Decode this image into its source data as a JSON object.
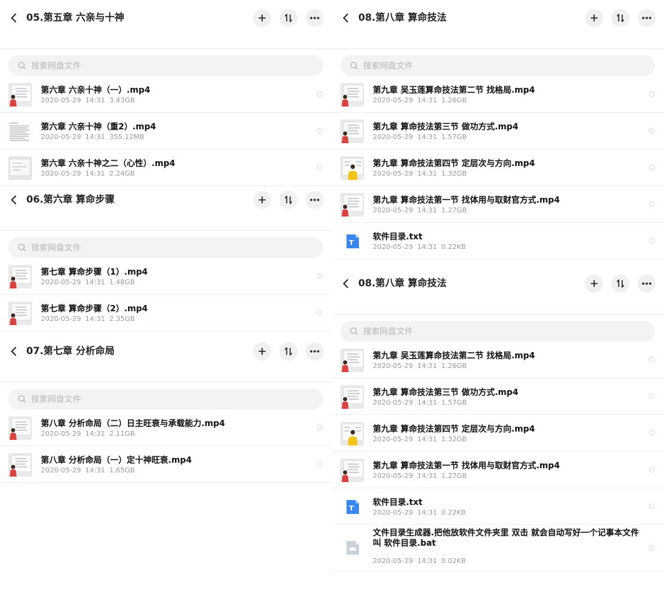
{
  "search_placeholder": "搜索网盘文件",
  "left": {
    "p1": {
      "title": "05.第五章  六亲与十神",
      "files": [
        {
          "name": "第六章  六亲十神（一）.mp4",
          "date": "2020-05-29",
          "time": "14:31",
          "size": "3.43GB",
          "thumb": "video-board"
        },
        {
          "name": "第六章 六亲十神（重2）.mp4",
          "date": "2020-05-29",
          "time": "14:31",
          "size": "355.12MB",
          "thumb": "document-page"
        },
        {
          "name": "第六章 六亲十神之二（心性）.mp4",
          "date": "2020-05-29",
          "time": "14:31",
          "size": "2.24GB",
          "thumb": "whiteboard"
        }
      ]
    },
    "p2": {
      "title": "06.第六章 算命步骤",
      "files": [
        {
          "name": "第七章  算命步骤（1）.mp4",
          "date": "2020-05-29",
          "time": "14:31",
          "size": "1.48GB",
          "thumb": "video-board"
        },
        {
          "name": "第七章 算命步骤（2）.mp4",
          "date": "2020-05-29",
          "time": "14:31",
          "size": "2.35GB",
          "thumb": "video-board"
        }
      ]
    },
    "p3": {
      "title": "07.第七章 分析命局",
      "files": [
        {
          "name": "第八章 分析命局（二）日主旺衰与承载能力.mp4",
          "date": "2020-05-29",
          "time": "14:31",
          "size": "2.11GB",
          "thumb": "video-board"
        },
        {
          "name": "第八章 分析命局（一）定十神旺衰.mp4",
          "date": "2020-05-29",
          "time": "14:31",
          "size": "1.65GB",
          "thumb": "video-board"
        }
      ]
    }
  },
  "right": {
    "p1": {
      "title": "08.第八章  算命技法",
      "files": [
        {
          "name": "第九章  吴玉莲算命技法第二节 找格局.mp4",
          "date": "2020-05-29",
          "time": "14:31",
          "size": "1.26GB",
          "thumb": "video-board"
        },
        {
          "name": "第九章 算命技法第三节 做功方式.mp4",
          "date": "2020-05-29",
          "time": "14:31",
          "size": "1.57GB",
          "thumb": "video-board"
        },
        {
          "name": "第九章 算命技法第四节 定层次与方向.mp4",
          "date": "2020-05-29",
          "time": "14:31",
          "size": "1.32GB",
          "thumb": "video-yellow"
        },
        {
          "name": "第九章 算命技法第一节 找体用与取财官方式.mp4",
          "date": "2020-05-29",
          "time": "14:31",
          "size": "1.27GB",
          "thumb": "video-board"
        },
        {
          "name": "软件目录.txt",
          "date": "2020-05-29",
          "time": "14:31",
          "size": "0.22KB",
          "thumb": "txt-icon",
          "icon_letter": "T"
        }
      ]
    },
    "p2": {
      "title": "08.第八章  算命技法",
      "files": [
        {
          "name": "第九章  吴玉莲算命技法第二节 找格局.mp4",
          "date": "2020-05-29",
          "time": "14:31",
          "size": "1.26GB",
          "thumb": "video-board"
        },
        {
          "name": "第九章 算命技法第三节 做功方式.mp4",
          "date": "2020-05-29",
          "time": "14:31",
          "size": "1.57GB",
          "thumb": "video-board"
        },
        {
          "name": "第九章 算命技法第四节 定层次与方向.mp4",
          "date": "2020-05-29",
          "time": "14:31",
          "size": "1.32GB",
          "thumb": "video-yellow"
        },
        {
          "name": "第九章 算命技法第一节 找体用与取财官方式.mp4",
          "date": "2020-05-29",
          "time": "14:31",
          "size": "1.27GB",
          "thumb": "video-board"
        },
        {
          "name": "软件目录.txt",
          "date": "2020-05-29",
          "time": "14:31",
          "size": "0.22KB",
          "thumb": "txt-icon",
          "icon_letter": "T"
        },
        {
          "name": "文件目录生成器.把他放软件文件夹里 双击 就会自动写好一个记事本文件 叫 软件目录.bat",
          "date": "2020-05-29",
          "time": "14:31",
          "size": "0.02KB",
          "thumb": "bat-icon"
        }
      ]
    }
  },
  "colors": {
    "accent_blue": "#3a87f2",
    "meta_gray": "#9a9a9a",
    "button_bg": "#f0f0f2"
  }
}
